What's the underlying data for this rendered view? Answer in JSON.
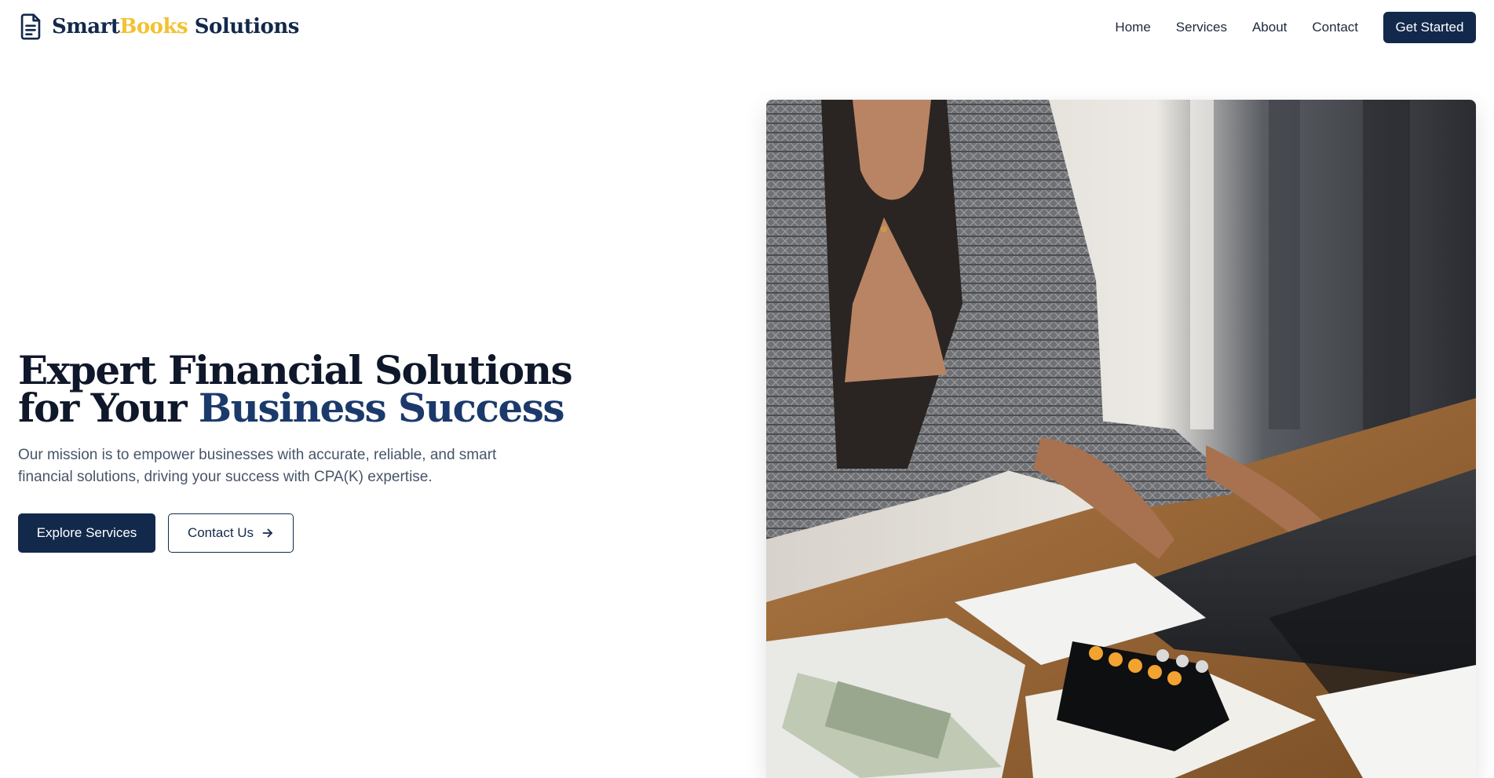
{
  "brand": {
    "name_part1": "Smart",
    "name_part2": "Books",
    "name_part3": " Solutions",
    "logo_icon": "document-icon",
    "colors": {
      "primary": "#13294b",
      "accent": "#f2c230"
    }
  },
  "nav": {
    "items": [
      {
        "label": "Home"
      },
      {
        "label": "Services"
      },
      {
        "label": "About"
      },
      {
        "label": "Contact"
      }
    ],
    "cta_label": "Get Started"
  },
  "hero": {
    "title_line1": "Expert Financial Solutions",
    "title_line2_prefix": "for Your ",
    "title_line2_accent": "Business Success",
    "mission": "Our mission is to empower businesses with accurate, reliable, and smart financial solutions, driving your success with CPA(K) expertise.",
    "primary_button": "Explore Services",
    "secondary_button": "Contact Us",
    "secondary_button_icon": "arrow-right-icon",
    "image_subject": "photo"
  }
}
